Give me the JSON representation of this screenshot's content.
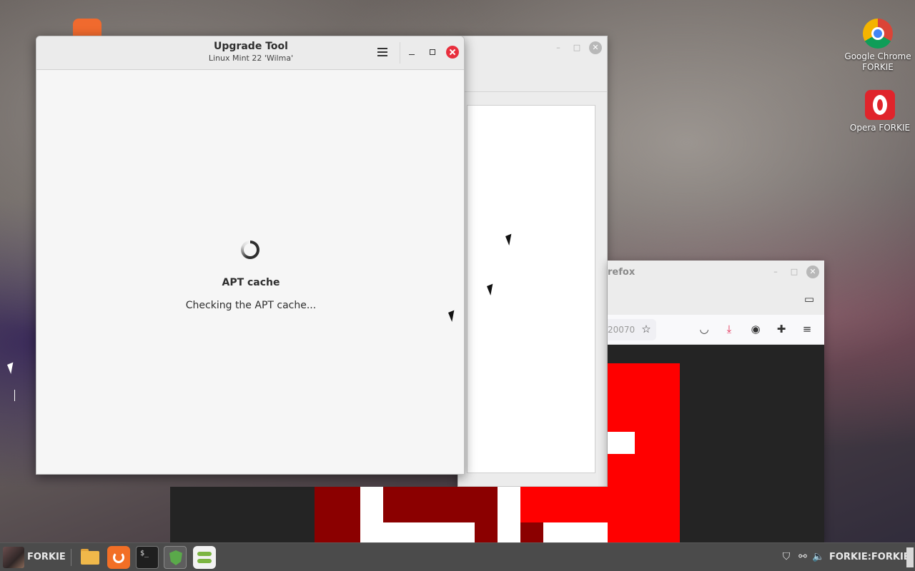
{
  "desktop": {
    "icons": [
      {
        "label_line1": "Google Chrome",
        "label_line2": "FORKIE",
        "icon": "chrome-icon"
      },
      {
        "label_line1": "Opera FORKIE",
        "label_line2": "",
        "icon": "opera-icon"
      }
    ]
  },
  "upgrade_window": {
    "title": "Upgrade Tool",
    "subtitle": "Linux Mint 22 'Wilma'",
    "heading": "APT cache",
    "status": "Checking the APT cache..."
  },
  "firefox_window": {
    "title_fragment": "refox",
    "url_fragment": "20070"
  },
  "taskbar": {
    "user_label": "FORKIE",
    "tray_label": "FORKIE:FORKIE"
  },
  "colors": {
    "close_red": "#e82f3d",
    "maze_red": "#ff0000",
    "maze_dark_red": "#8b0000",
    "taskbar_bg": "#4b4b4b"
  }
}
